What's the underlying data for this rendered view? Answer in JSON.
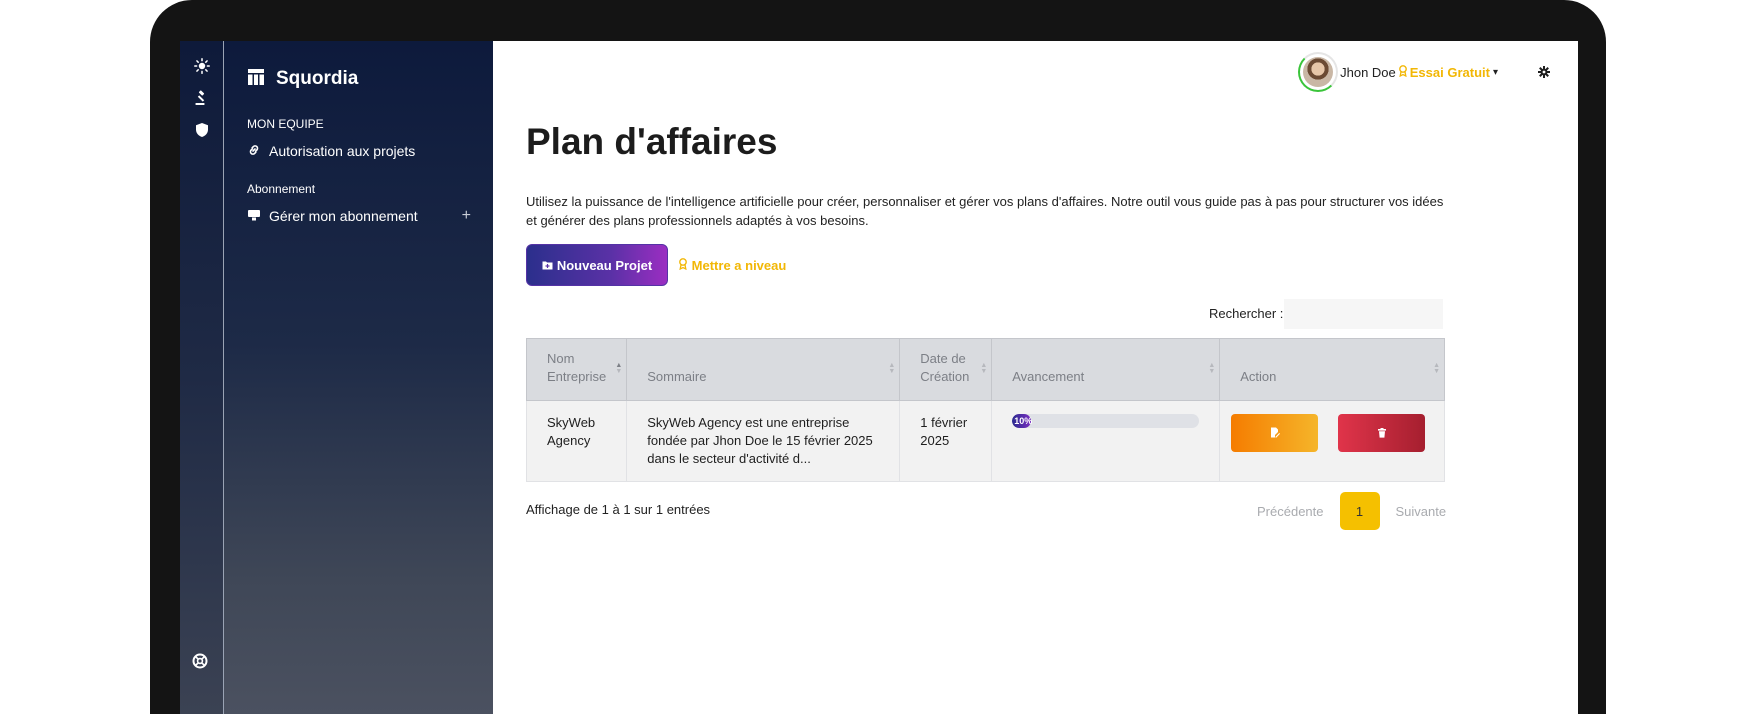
{
  "brand": {
    "name": "Squordia"
  },
  "sidebar": {
    "sections": [
      {
        "heading": "MON EQUIPE",
        "items": [
          {
            "label": "Autorisation aux projets",
            "icon": "link-icon"
          }
        ]
      },
      {
        "heading": "Abonnement",
        "items": [
          {
            "label": "Gérer mon abonnement",
            "icon": "billing-icon",
            "expand": "+"
          }
        ]
      }
    ]
  },
  "header": {
    "user_name": "Jhon Doe",
    "plan_badge": "Essai Gratuit",
    "caret": "▾"
  },
  "page": {
    "title": "Plan d'affaires",
    "description": "Utilisez la puissance de l'intelligence artificielle pour créer, personnaliser et gérer vos plans d'affaires. Notre outil vous guide pas à pas pour structurer vos idées et générer des plans professionnels adaptés à vos besoins.",
    "new_project_label": "Nouveau Projet",
    "upgrade_label": "Mettre a niveau"
  },
  "search": {
    "label": "Rechercher :",
    "value": "",
    "placeholder": ""
  },
  "table": {
    "columns": [
      {
        "line1": "Nom",
        "line2": "Entreprise"
      },
      {
        "line1": "",
        "line2": "Sommaire"
      },
      {
        "line1": "Date de",
        "line2": "Création"
      },
      {
        "line1": "",
        "line2": "Avancement"
      },
      {
        "line1": "",
        "line2": "Action"
      }
    ],
    "rows": [
      {
        "company_l1": "SkyWeb",
        "company_l2": "Agency",
        "summary": "SkyWeb Agency est une entreprise fondée par Jhon Doe le 15 février 2025 dans le secteur d'activité d...",
        "date_l1": "1 février",
        "date_l2": "2025",
        "progress_label": "10%",
        "progress_value": 10
      }
    ]
  },
  "footer": {
    "info": "Affichage de 1 à 1 sur 1 entrées",
    "prev": "Précédente",
    "page": "1",
    "next": "Suivante"
  },
  "colors": {
    "accent_yellow": "#f2b705",
    "primary_purple": "#5a31a6",
    "edit_orange": "#f57c00",
    "delete_red": "#d12c40"
  }
}
